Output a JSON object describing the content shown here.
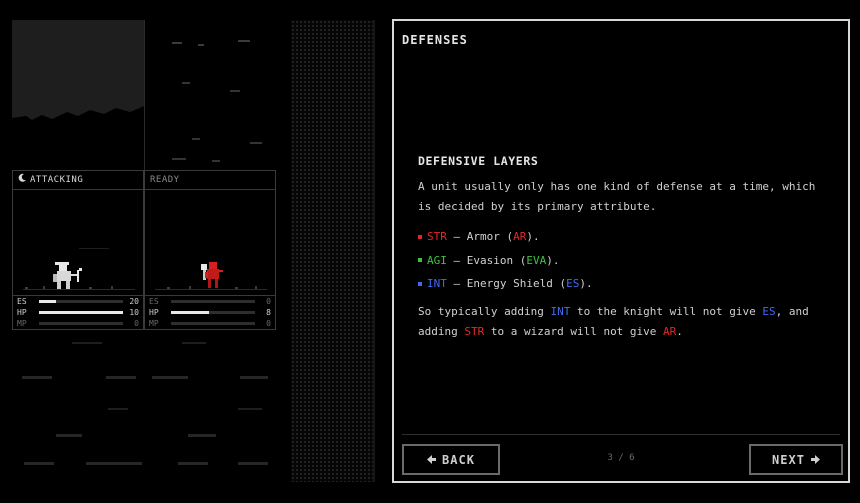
{
  "units": [
    {
      "status": "ATTACKING",
      "status_icon": "moon-icon",
      "stats": [
        {
          "label": "ES",
          "value": "20",
          "fraction": 0.2
        },
        {
          "label": "HP",
          "value": "10",
          "fraction": 1.0
        },
        {
          "label": "MP",
          "value": "0",
          "fraction": 0
        }
      ]
    },
    {
      "status": "READY",
      "stats": [
        {
          "label": "ES",
          "value": "0",
          "fraction": 0
        },
        {
          "label": "HP",
          "value": "8",
          "fraction": 0.45
        },
        {
          "label": "MP",
          "value": "0",
          "fraction": 0
        }
      ]
    }
  ],
  "dialog": {
    "title": "DEFENSES",
    "section_title": "DEFENSIVE LAYERS",
    "intro": "A unit usually only has one kind of defense at a time, which is decided by its primary attribute.",
    "bullets": [
      {
        "stat": "STR",
        "sep": " — ",
        "name": "Armor (",
        "abbr": "AR",
        "end": ").",
        "color": "#e32727"
      },
      {
        "stat": "AGI",
        "sep": " — ",
        "name": "Evasion (",
        "abbr": "EVA",
        "end": ").",
        "color": "#3ec23e"
      },
      {
        "stat": "INT",
        "sep": " — ",
        "name": "Energy Shield (",
        "abbr": "ES",
        "end": ").",
        "color": "#3e6af2"
      }
    ],
    "outro": {
      "p1": "So typically adding ",
      "int": "INT",
      "p2": " to the knight will not give ",
      "es": "ES",
      "p3": ", and adding ",
      "str": "STR",
      "p4": " to a wizard will not give ",
      "ar": "AR",
      "p5": "."
    },
    "back_label": "BACK",
    "next_label": "NEXT",
    "page_indicator": "3 / 6"
  },
  "colors": {
    "str": "#e32727",
    "agi": "#3ec23e",
    "int": "#3e6af2"
  }
}
